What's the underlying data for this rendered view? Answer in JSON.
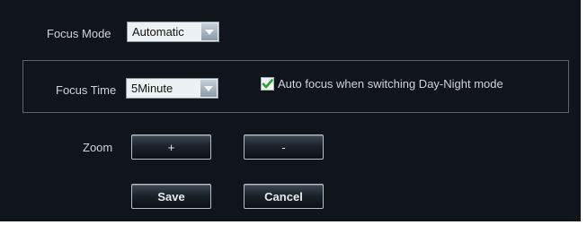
{
  "focus_mode": {
    "label": "Focus Mode",
    "value": "Automatic"
  },
  "focus_time": {
    "label": "Focus Time",
    "value": "5Minute"
  },
  "auto_focus": {
    "checked": true,
    "label": "Auto focus when switching Day-Night mode"
  },
  "zoom": {
    "label": "Zoom",
    "in_label": "+",
    "out_label": "-"
  },
  "actions": {
    "save_label": "Save",
    "cancel_label": "Cancel"
  },
  "icons": {
    "dropdown": "chevron-down-icon",
    "check": "checkmark-icon"
  },
  "colors": {
    "panel_background": "#10151b",
    "check_mark": "#2aa52a"
  }
}
